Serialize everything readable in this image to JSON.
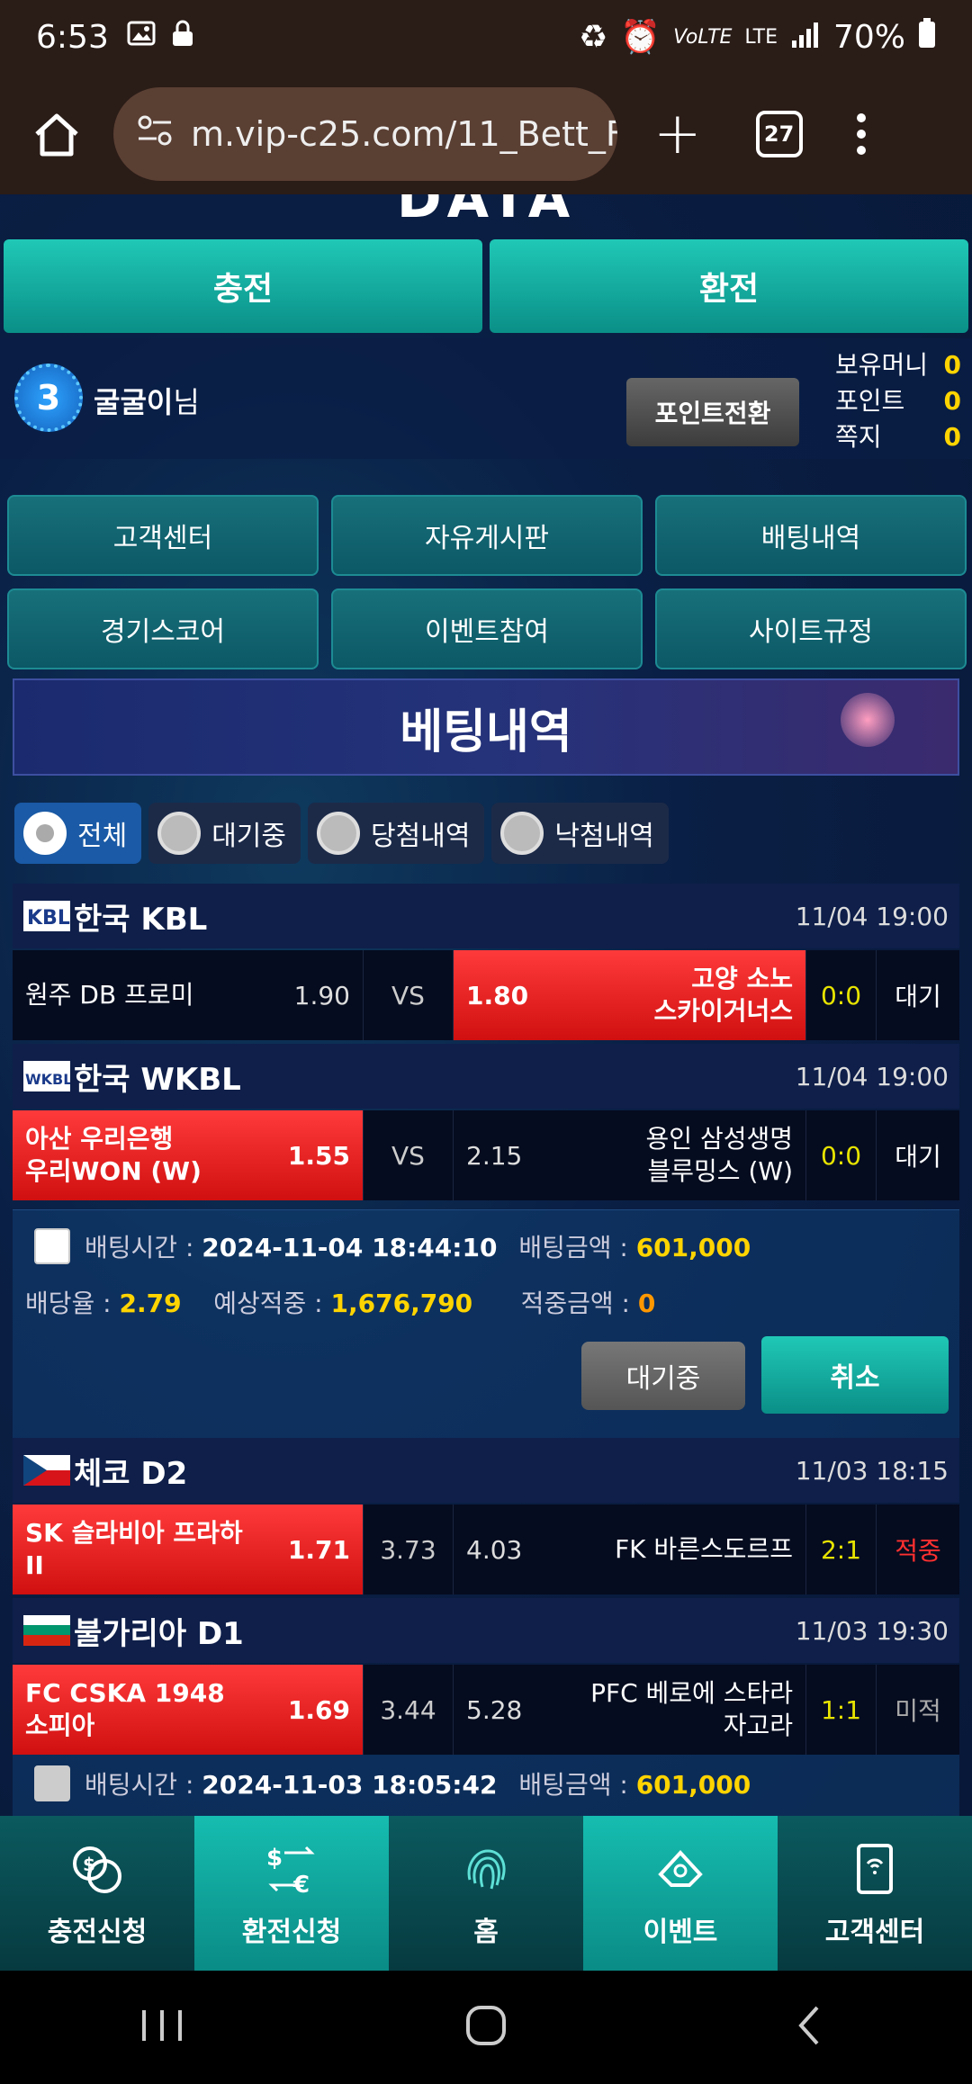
{
  "status_bar": {
    "time": "6:53",
    "battery": "70%",
    "network": "LTE"
  },
  "browser": {
    "url": "m.vip-c25.com/11_Bett_F",
    "tab_count": "27"
  },
  "header": {
    "logo_partial": "DATA",
    "charge_label": "충전",
    "exchange_label": "환전"
  },
  "user": {
    "level": "3",
    "name": "굴굴이",
    "suffix": "님",
    "point_convert_label": "포인트전환",
    "money_label": "보유머니",
    "money_value": "0",
    "point_label": "포인트",
    "point_value": "0",
    "message_label": "쪽지",
    "message_value": "0"
  },
  "menu": {
    "items": [
      "고객센터",
      "자유게시판",
      "배팅내역",
      "경기스코어",
      "이벤트참여",
      "사이트규정"
    ]
  },
  "banner": {
    "title": "베팅내역"
  },
  "filters": {
    "all": "전체",
    "pending": "대기중",
    "won": "당첨내역",
    "lost": "낙첨내역"
  },
  "bets": [
    {
      "league": "한국 KBL",
      "date": "11/04 19:00",
      "home": "원주 DB 프로미",
      "home_odd": "1.90",
      "vs": "VS",
      "away_odd": "1.80",
      "away_line1": "고양 소노",
      "away_line2": "스카이거너스",
      "score": "0:0",
      "status": "대기"
    },
    {
      "league": "한국 WKBL",
      "date": "11/04 19:00",
      "home_line1": "아산 우리은행",
      "home_line2": "우리WON (W)",
      "home_odd": "1.55",
      "vs": "VS",
      "away_odd": "2.15",
      "away_line1": "용인 삼성생명",
      "away_line2": "블루밍스 (W)",
      "score": "0:0",
      "status": "대기"
    },
    {
      "league": "체코 D2",
      "date": "11/03 18:15",
      "home_line1": "SK 슬라비아 프라하",
      "home_line2": "II",
      "home_odd": "1.71",
      "draw_odd": "3.73",
      "away_odd": "4.03",
      "away": "FK 바른스도르프",
      "score": "2:1",
      "status": "적중"
    },
    {
      "league": "불가리아 D1",
      "date": "11/03 19:30",
      "home_line1": "FC CSKA 1948",
      "home_line2": "소피아",
      "home_odd": "1.69",
      "draw_odd": "3.44",
      "away_odd": "5.28",
      "away_line1": "PFC 베로에 스타라",
      "away_line2": "자고라",
      "score": "1:1",
      "status": "미적"
    }
  ],
  "bet_slip_1": {
    "time_label": "배팅시간 :",
    "time_value": "2024-11-04 18:44:10",
    "amount_label": "배팅금액 :",
    "amount_value": "601,000",
    "rate_label": "배당율 :",
    "rate_value": "2.79",
    "expected_label": "예상적중 :",
    "expected_value": "1,676,790",
    "hit_label": "적중금액 :",
    "hit_value": "0",
    "wait_label": "대기중",
    "cancel_label": "취소"
  },
  "bet_slip_2": {
    "time_label": "배팅시간 :",
    "time_value": "2024-11-03 18:05:42",
    "amount_label": "배팅금액 :",
    "amount_value": "601,000"
  },
  "bottom_nav": {
    "charge": "충전신청",
    "exchange": "환전신청",
    "home": "홈",
    "event": "이벤트",
    "support": "고객센터"
  },
  "colors": {
    "teal": "#14b3a6",
    "selected_red": "#e82020",
    "highlight_yellow": "#ffd400",
    "score_yellow": "#e8e400"
  }
}
